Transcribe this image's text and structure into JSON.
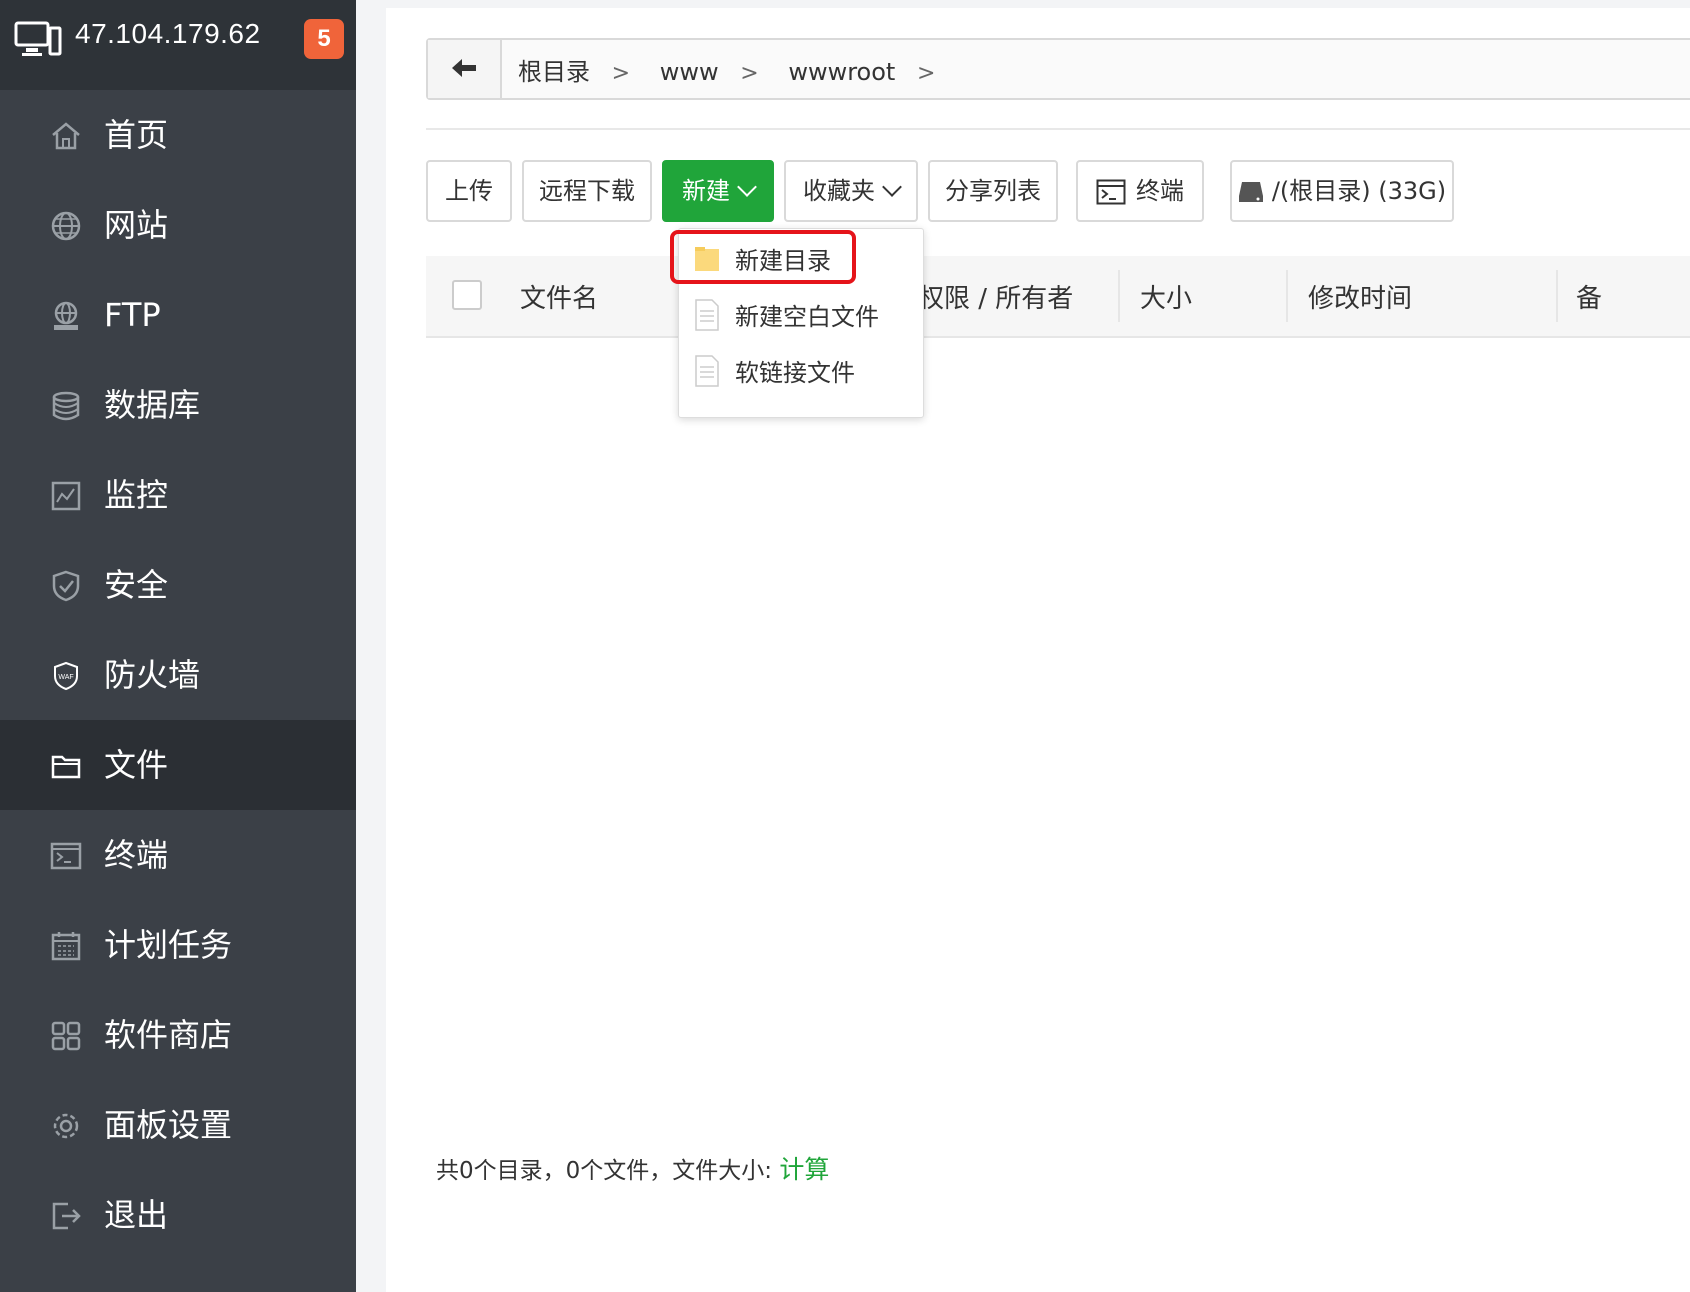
{
  "server": {
    "ip": "47.104.179.62",
    "badge": "5"
  },
  "nav": {
    "items": [
      {
        "label": "首页",
        "icon": "home-icon"
      },
      {
        "label": "网站",
        "icon": "globe-icon"
      },
      {
        "label": "FTP",
        "icon": "ftp-icon"
      },
      {
        "label": "数据库",
        "icon": "database-icon"
      },
      {
        "label": "监控",
        "icon": "monitor-icon"
      },
      {
        "label": "安全",
        "icon": "shield-icon"
      },
      {
        "label": "防火墙",
        "icon": "waf-icon"
      },
      {
        "label": "文件",
        "icon": "folder-icon",
        "active": true
      },
      {
        "label": "终端",
        "icon": "terminal-icon"
      },
      {
        "label": "计划任务",
        "icon": "calendar-icon"
      },
      {
        "label": "软件商店",
        "icon": "apps-icon"
      },
      {
        "label": "面板设置",
        "icon": "gear-icon"
      },
      {
        "label": "退出",
        "icon": "logout-icon"
      }
    ]
  },
  "breadcrumb": {
    "items": [
      "根目录",
      "www",
      "wwwroot"
    ],
    "separator": ">"
  },
  "toolbar": {
    "upload": "上传",
    "remote_download": "远程下载",
    "new": "新建",
    "favorites": "收藏夹",
    "share_list": "分享列表",
    "terminal": "终端",
    "disk": "/(根目录) (33G)"
  },
  "new_menu": {
    "items": [
      "新建目录",
      "新建空白文件",
      "软链接文件"
    ]
  },
  "table": {
    "headers": [
      "文件名",
      "权限 / 所有者",
      "大小",
      "修改时间",
      "备"
    ]
  },
  "footer": {
    "summary": "共0个目录，0个文件，文件大小: ",
    "calc": "计算"
  },
  "colors": {
    "accent": "#20a53a",
    "badge": "#f0643a",
    "highlight": "#e5141a",
    "sidebar": "#3b4047"
  }
}
